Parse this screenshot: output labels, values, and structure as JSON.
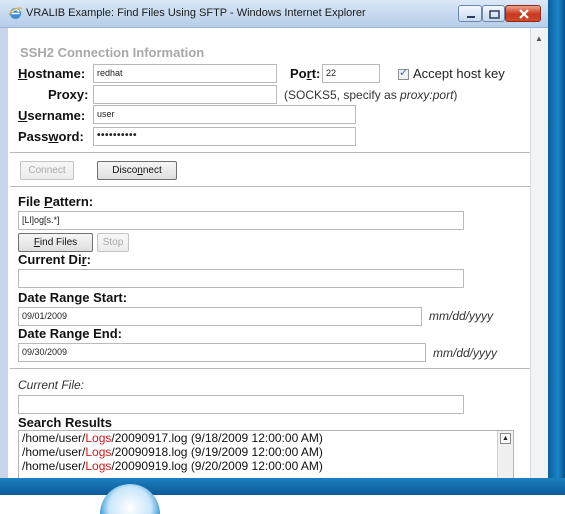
{
  "window": {
    "title": "VRALIB Example: Find Files Using SFTP - Windows Internet Explorer"
  },
  "connection": {
    "section_title": "SSH2 Connection Information",
    "hostname_label": "Hostname:",
    "hostname_value": "redhat",
    "port_label": "Port:",
    "port_value": "22",
    "accept_host_key_label": "Accept host key",
    "accept_host_key_checked": true,
    "proxy_label": "Proxy:",
    "proxy_value": "",
    "proxy_hint": "(SOCKS5, specify as ",
    "proxy_hint_format": "proxy:port",
    "proxy_hint_end": ")",
    "username_label": "Username:",
    "username_value": "user",
    "password_label": "Password:",
    "password_value": "••••••••••",
    "connect_label": "Connect",
    "disconnect_label": "Disconnect"
  },
  "search": {
    "file_pattern_label": "File Pattern:",
    "file_pattern_value": "[Ll]og[s.*]",
    "find_files_label": "Find Files",
    "stop_label": "Stop",
    "current_dir_label": "Current Dir:",
    "current_dir_value": "",
    "date_start_label": "Date Range Start:",
    "date_start_value": "09/01/2009",
    "date_end_label": "Date Range End:",
    "date_end_value": "09/30/2009",
    "date_format_hint": "mm/dd/yyyy",
    "current_file_label": "Current File:",
    "current_file_value": "",
    "results_label": "Search Results",
    "results": [
      {
        "prefix": "/home/user/",
        "match": "Logs",
        "suffix": "/20090917.log (9/18/2009 12:00:00 AM)"
      },
      {
        "prefix": "/home/user/",
        "match": "Logs",
        "suffix": "/20090918.log (9/19/2009 12:00:00 AM)"
      },
      {
        "prefix": "/home/user/",
        "match": "Logs",
        "suffix": "/20090919.log (9/20/2009 12:00:00 AM)"
      }
    ]
  }
}
